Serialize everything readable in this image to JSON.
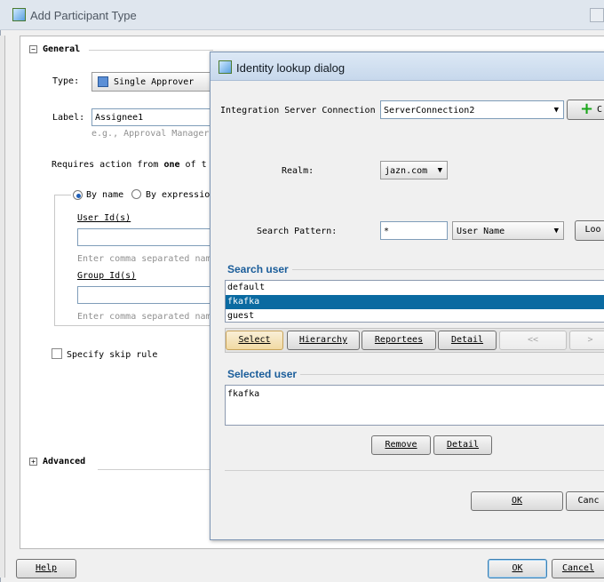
{
  "window": {
    "title": "Add Participant Type"
  },
  "general": {
    "section_label": "General",
    "type_label": "Type:",
    "type_value": "Single Approver",
    "label_label": "Label:",
    "label_value": "Assignee1",
    "label_hint": "e.g., Approval Manager",
    "requires_prefix": "Requires action from ",
    "requires_bold": "one",
    "requires_suffix": " of t",
    "by_name": "By name",
    "by_expression": "By expression",
    "user_ids_label": "User Id(s)",
    "user_ids_hint": "Enter comma separated nam",
    "group_ids_label": "Group Id(s)",
    "group_ids_hint": "Enter comma separated nam",
    "skip_rule": "Specify skip rule"
  },
  "advanced": {
    "section_label": "Advanced"
  },
  "footer": {
    "help": "Help",
    "ok": "OK",
    "cancel": "Cancel"
  },
  "dialog": {
    "title": "Identity lookup dialog",
    "isc_label": "Integration Server Connection",
    "isc_value": "ServerConnection2",
    "isc_button": "C",
    "realm_label": "Realm:",
    "realm_value": "jazn.com",
    "search_pattern_label": "Search Pattern:",
    "search_pattern_value": "*",
    "search_by_value": "User Name",
    "lookup_button": "Loo",
    "search_user_title": "Search user",
    "users": [
      "default",
      "fkafka",
      "guest"
    ],
    "buttons": {
      "select": "Select",
      "hierarchy": "Hierarchy",
      "reportees": "Reportees",
      "detail": "Detail",
      "prev": "<<",
      "next": ">"
    },
    "selected_user_title": "Selected user",
    "selected_users": [
      "fkafka"
    ],
    "remove": "Remove",
    "detail2": "Detail",
    "ok": "OK",
    "cancel": "Canc"
  }
}
